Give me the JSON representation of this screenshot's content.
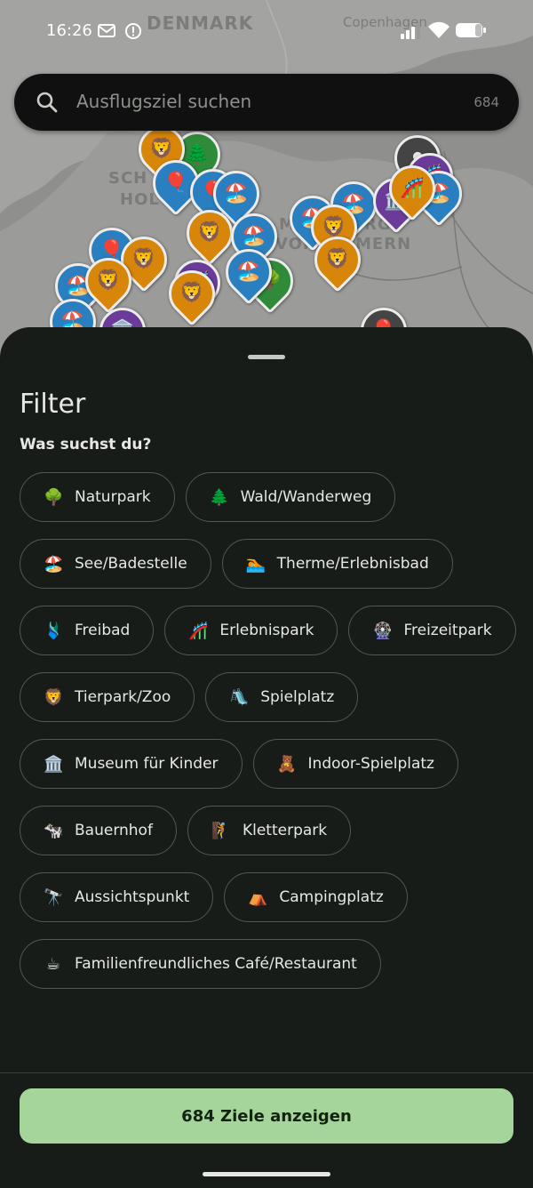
{
  "status_bar": {
    "time": "16:26"
  },
  "map": {
    "labels": {
      "country_denmark": "DENMARK",
      "city_copenhagen": "Copenhagen",
      "region_sh_1": "SCH",
      "region_sh_2": "HOL",
      "region_mv_1": "M",
      "region_mv_2": "VORP",
      "region_mv_3": "MERN",
      "region_mv_4": "RG"
    }
  },
  "search": {
    "placeholder": "Ausflugsziel suchen",
    "count": "684"
  },
  "filter": {
    "title": "Filter",
    "subtitle": "Was suchst du?",
    "chips": [
      {
        "emoji": "🌳",
        "label": "Naturpark"
      },
      {
        "emoji": "🌲",
        "label": "Wald/Wanderweg"
      },
      {
        "emoji": "🏖️",
        "label": "See/Badestelle"
      },
      {
        "emoji": "🏊",
        "label": "Therme/Erlebnisbad"
      },
      {
        "emoji": "🩱",
        "label": "Freibad"
      },
      {
        "emoji": "🎢",
        "label": "Erlebnispark"
      },
      {
        "emoji": "🎡",
        "label": "Freizeitpark"
      },
      {
        "emoji": "🦁",
        "label": "Tierpark/Zoo"
      },
      {
        "emoji": "🛝",
        "label": "Spielplatz"
      },
      {
        "emoji": "🏛️",
        "label": "Museum für Kinder"
      },
      {
        "emoji": "🧸",
        "label": "Indoor-Spielplatz"
      },
      {
        "emoji": "🐄",
        "label": "Bauernhof"
      },
      {
        "emoji": "🧗",
        "label": "Kletterpark"
      },
      {
        "emoji": "🔭",
        "label": "Aussichtspunkt"
      },
      {
        "emoji": "⛺",
        "label": "Campingplatz"
      },
      {
        "emoji": "☕",
        "label": "Familienfreundliches Café/Restaurant"
      }
    ],
    "show_button": "684 Ziele anzeigen"
  },
  "colors": {
    "sheet_bg": "#181c18",
    "accent_button": "#a6d59c",
    "chip_border": "#52574f"
  }
}
